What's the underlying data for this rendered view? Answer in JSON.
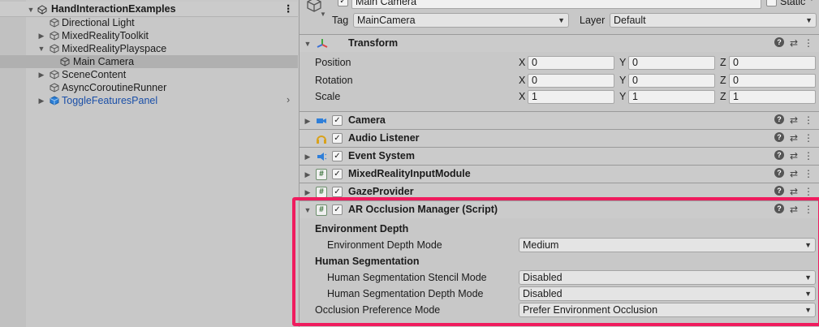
{
  "hierarchy": {
    "scene_name": "HandInteractionExamples",
    "scene_menu_icon": "kebab-menu-icon",
    "items": [
      {
        "label": "Directional Light"
      },
      {
        "label": "MixedRealityToolkit"
      },
      {
        "label": "MixedRealityPlayspace"
      },
      {
        "label": "Main Camera"
      },
      {
        "label": "SceneContent"
      },
      {
        "label": "AsyncCoroutineRunner"
      },
      {
        "label": "ToggleFeaturesPanel"
      }
    ]
  },
  "inspector": {
    "object_name": "Main Camera",
    "static_label": "Static",
    "tag_label": "Tag",
    "tag_value": "MainCamera",
    "layer_label": "Layer",
    "layer_value": "Default",
    "transform": {
      "title": "Transform",
      "rows": [
        {
          "label": "Position",
          "x": "0",
          "y": "0",
          "z": "0"
        },
        {
          "label": "Rotation",
          "x": "0",
          "y": "0",
          "z": "0"
        },
        {
          "label": "Scale",
          "x": "1",
          "y": "1",
          "z": "1"
        }
      ],
      "axis_x": "X",
      "axis_y": "Y",
      "axis_z": "Z"
    },
    "components": [
      {
        "title": "Camera"
      },
      {
        "title": "Audio Listener"
      },
      {
        "title": "Event System"
      },
      {
        "title": "MixedRealityInputModule"
      },
      {
        "title": "GazeProvider"
      }
    ],
    "ar_occlusion": {
      "title": "AR Occlusion Manager (Script)",
      "env_depth_header": "Environment Depth",
      "env_depth_mode_label": "Environment Depth Mode",
      "env_depth_mode_value": "Medium",
      "human_seg_header": "Human Segmentation",
      "stencil_label": "Human Segmentation Stencil Mode",
      "stencil_value": "Disabled",
      "depth_label": "Human Segmentation Depth Mode",
      "depth_value": "Disabled",
      "pref_label": "Occlusion Preference Mode",
      "pref_value": "Prefer Environment Occlusion"
    },
    "highlight_color": "#ef1c5e"
  }
}
